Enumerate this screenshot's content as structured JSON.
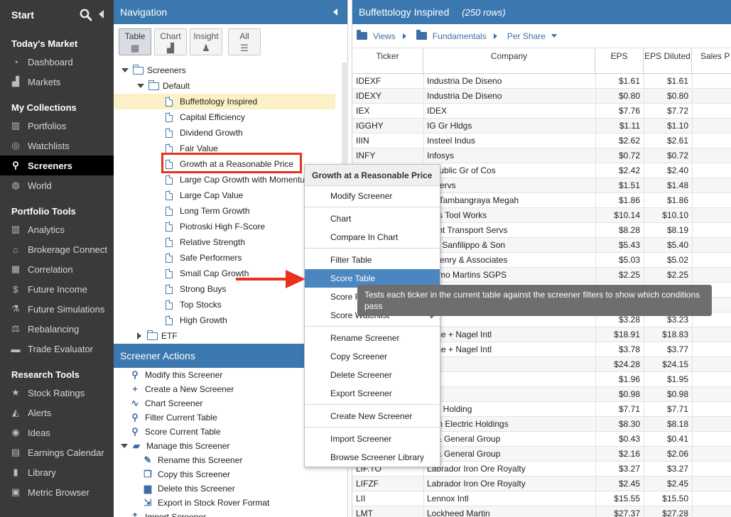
{
  "sidebar": {
    "start_label": "Start",
    "sections": [
      {
        "title": "Today's Market",
        "items": [
          {
            "label": "Dashboard",
            "icon": "gauge-icon"
          },
          {
            "label": "Markets",
            "icon": "area-chart-icon"
          }
        ]
      },
      {
        "title": "My Collections",
        "items": [
          {
            "label": "Portfolios",
            "icon": "briefcase-icon"
          },
          {
            "label": "Watchlists",
            "icon": "binoculars-icon"
          },
          {
            "label": "Screeners",
            "icon": "search-icon"
          },
          {
            "label": "World",
            "icon": "globe-icon"
          }
        ]
      },
      {
        "title": "Portfolio Tools",
        "items": [
          {
            "label": "Analytics",
            "icon": "bar-chart-icon"
          },
          {
            "label": "Brokerage Connect",
            "icon": "bank-icon"
          },
          {
            "label": "Correlation",
            "icon": "grid-icon"
          },
          {
            "label": "Future Income",
            "icon": "dollar-icon"
          },
          {
            "label": "Future Simulations",
            "icon": "flask-icon"
          },
          {
            "label": "Rebalancing",
            "icon": "scale-icon"
          },
          {
            "label": "Trade Evaluator",
            "icon": "toolbox-icon"
          }
        ]
      },
      {
        "title": "Research Tools",
        "items": [
          {
            "label": "Stock Ratings",
            "icon": "star-icon"
          },
          {
            "label": "Alerts",
            "icon": "bell-icon"
          },
          {
            "label": "Ideas",
            "icon": "lightbulb-icon"
          },
          {
            "label": "Earnings Calendar",
            "icon": "calendar-icon"
          },
          {
            "label": "Library",
            "icon": "book-icon"
          },
          {
            "label": "Metric Browser",
            "icon": "window-icon"
          }
        ]
      }
    ],
    "active_item": "Screeners"
  },
  "navigation": {
    "title": "Navigation",
    "tabs": [
      "Table",
      "Chart",
      "Insight",
      "All"
    ],
    "active_tab": "Table",
    "tree": {
      "root": "Screeners",
      "folder": "Default",
      "items": [
        "Buffettology Inspired",
        "Capital Efficiency",
        "Dividend Growth",
        "Fair Value",
        "Growth at a Reasonable Price",
        "Large Cap Growth with Momentum",
        "Large Cap Value",
        "Long Term Growth",
        "Piotroski High F-Score",
        "Relative Strength",
        "Safe Performers",
        "Small Cap Growth",
        "Strong Buys",
        "Top Stocks",
        "High Growth"
      ],
      "collapsed_folder": "ETF",
      "selected": "Buffettology Inspired"
    }
  },
  "screener_actions": {
    "title": "Screener Actions",
    "items": [
      {
        "label": "Modify this Screener",
        "icon": "search-icon",
        "indent": 0
      },
      {
        "label": "Create a New Screener",
        "icon": "plus-icon",
        "indent": 0
      },
      {
        "label": "Chart Screener",
        "icon": "line-chart-icon",
        "indent": 0
      },
      {
        "label": "Filter Current Table",
        "icon": "search-icon",
        "indent": 0
      },
      {
        "label": "Score Current Table",
        "icon": "search-icon",
        "indent": 0
      },
      {
        "label": "Manage this Screener",
        "icon": "folder-icon",
        "indent": 0
      },
      {
        "label": "Rename this Screener",
        "icon": "edit-icon",
        "indent": 1
      },
      {
        "label": "Copy this Screener",
        "icon": "copy-icon",
        "indent": 1
      },
      {
        "label": "Delete this Screener",
        "icon": "trash-icon",
        "indent": 1
      },
      {
        "label": "Export in Stock Rover Format",
        "icon": "export-icon",
        "indent": 1
      },
      {
        "label": "Import Screener",
        "icon": "import-icon",
        "indent": 0
      }
    ]
  },
  "table_panel": {
    "title": "Buffettology Inspired",
    "rows_label": "(250 rows)",
    "views_bar": [
      "Views",
      "Fundamentals",
      "Per Share"
    ],
    "columns": [
      "Ticker",
      "Company",
      "EPS",
      "EPS Diluted",
      "Sales P"
    ],
    "rows": [
      [
        "IDEXF",
        "Industria De Diseno",
        "$1.61",
        "$1.61"
      ],
      [
        "IDEXY",
        "Industria De Diseno",
        "$0.80",
        "$0.80"
      ],
      [
        "IEX",
        "IDEX",
        "$7.76",
        "$7.72"
      ],
      [
        "IGGHY",
        "IG Gr Hldgs",
        "$1.11",
        "$1.10"
      ],
      [
        "IIIN",
        "Insteel Indus",
        "$2.62",
        "$2.61"
      ],
      [
        "INFY",
        "Infosys",
        "$0.72",
        "$0.72"
      ],
      [
        "",
        "erpublic Gr of Cos",
        "$2.42",
        "$2.40"
      ],
      [
        "",
        "o Servs",
        "$1.51",
        "$1.48"
      ],
      [
        "",
        "do Tambangraya Megah",
        "$1.86",
        "$1.86"
      ],
      [
        "",
        "nois Tool Works",
        "$10.14",
        "$10.10"
      ],
      [
        "",
        "Hunt Transport Servs",
        "$8.28",
        "$8.19"
      ],
      [
        "",
        "n B Sanfilippo & Son",
        "$5.43",
        "$5.40"
      ],
      [
        "",
        "k Henry & Associates",
        "$5.03",
        "$5.02"
      ],
      [
        "",
        "onimo Martins SGPS",
        "$2.25",
        "$2.25"
      ],
      [
        "",
        "",
        "",
        ""
      ],
      [
        "",
        "",
        "",
        ""
      ],
      [
        "",
        "rce",
        "$3.28",
        "$3.23"
      ],
      [
        "",
        "ehne + Nagel Intl",
        "$18.91",
        "$18.83"
      ],
      [
        "",
        "ehne + Nagel Intl",
        "$3.78",
        "$3.77"
      ],
      [
        "",
        "A",
        "$24.28",
        "$24.15"
      ],
      [
        "",
        "NE",
        "$1.96",
        "$1.95"
      ],
      [
        "",
        "NE",
        "$0.98",
        "$0.98"
      ],
      [
        "",
        "dex Holding",
        "$7.71",
        "$7.71"
      ],
      [
        "",
        "coln Electric Holdings",
        "$8.30",
        "$8.18"
      ],
      [
        "",
        "al & General Group",
        "$0.43",
        "$0.41"
      ],
      [
        "",
        "al & General Group",
        "$2.16",
        "$2.06"
      ],
      [
        "LIF.TO",
        "Labrador Iron Ore Royalty",
        "$3.27",
        "$3.27"
      ],
      [
        "LIFZF",
        "Labrador Iron Ore Royalty",
        "$2.45",
        "$2.45"
      ],
      [
        "LII",
        "Lennox Intl",
        "$15.55",
        "$15.50"
      ],
      [
        "LMT",
        "Lockheed Martin",
        "$27.37",
        "$27.28"
      ]
    ]
  },
  "context_menu": {
    "title": "Growth at a Reasonable Price",
    "groups": [
      [
        "Modify Screener"
      ],
      [
        "Chart",
        "Compare In Chart"
      ],
      [
        "Filter Table",
        "Score Table",
        "Score P",
        "Score Watchlist"
      ],
      [
        "Rename Screener",
        "Copy Screener",
        "Delete Screener",
        "Export Screener"
      ],
      [
        "Create New Screener"
      ],
      [
        "Import Screener",
        "Browse Screener Library"
      ]
    ],
    "highlighted": "Score Table"
  },
  "tooltip": {
    "text": "Tests each ticker in the current table against the screener filters to show which conditions pass"
  },
  "colors": {
    "header_blue": "#3c78b0",
    "sidebar_dark": "#3a3a3a",
    "highlight_red": "#e8321e",
    "menu_highlight": "#4c86c0",
    "selected_row": "#fbf0c6"
  }
}
